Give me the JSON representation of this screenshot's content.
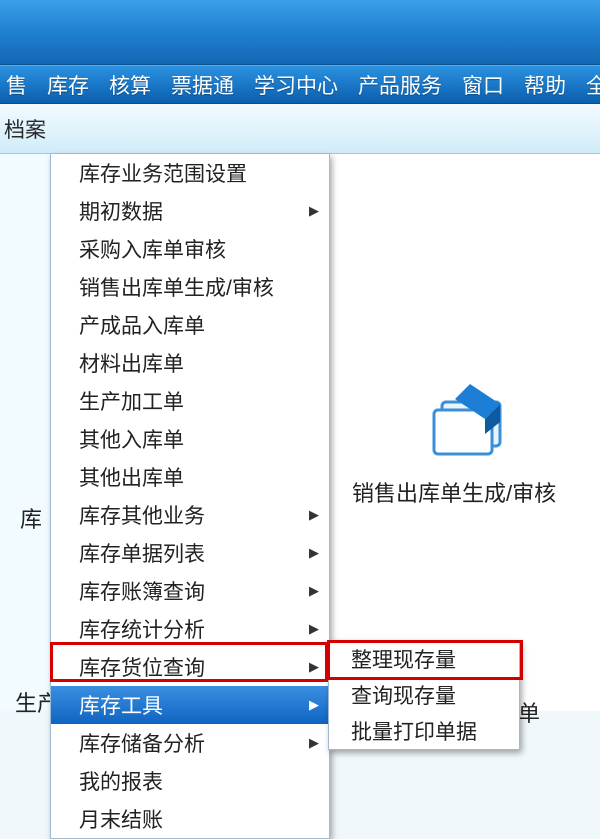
{
  "menu": {
    "items": [
      "售",
      "库存",
      "核算",
      "票据通",
      "学习中心",
      "产品服务",
      "窗口",
      "帮助",
      "全"
    ]
  },
  "crumb": {
    "left": "档案"
  },
  "dropdown": {
    "items": [
      {
        "label": "库存业务范围设置",
        "sub": false
      },
      {
        "label": "期初数据",
        "sub": true
      },
      {
        "label": "采购入库单审核",
        "sub": false
      },
      {
        "label": "销售出库单生成/审核",
        "sub": false
      },
      {
        "label": "产成品入库单",
        "sub": false
      },
      {
        "label": "材料出库单",
        "sub": false
      },
      {
        "label": "生产加工单",
        "sub": false
      },
      {
        "label": "其他入库单",
        "sub": false
      },
      {
        "label": "其他出库单",
        "sub": false
      },
      {
        "label": "库存其他业务",
        "sub": true
      },
      {
        "label": "库存单据列表",
        "sub": true
      },
      {
        "label": "库存账簿查询",
        "sub": true
      },
      {
        "label": "库存统计分析",
        "sub": true
      },
      {
        "label": "库存货位查询",
        "sub": true
      },
      {
        "label": "库存工具",
        "sub": true,
        "highlight": true
      },
      {
        "label": "库存储备分析",
        "sub": true
      },
      {
        "label": "我的报表",
        "sub": false
      },
      {
        "label": "月末结账",
        "sub": false
      }
    ]
  },
  "submenu": {
    "items": [
      "整理现存量",
      "查询现存量",
      "批量打印单据"
    ]
  },
  "bg": {
    "left_short": "库",
    "right_label": "销售出库单生成/审核",
    "left_bottom": "生产",
    "right_bottom": "材料出库单"
  }
}
